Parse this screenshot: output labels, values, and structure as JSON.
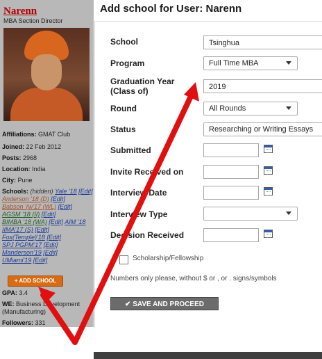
{
  "sidebar": {
    "name": "Narenn",
    "role": "MBA Section Director",
    "affiliations_label": "Affiliations:",
    "affiliations_value": "GMAT Club",
    "joined_label": "Joined:",
    "joined_value": "22 Feb 2012",
    "posts_label": "Posts:",
    "posts_value": "2968",
    "location_label": "Location:",
    "location_value": "India",
    "city_label": "City:",
    "city_value": "Pune",
    "schools_label": "Schools:",
    "schools_hidden": "(hidden)",
    "schools": [
      {
        "text": "Yale '18",
        "edit": "[Edit]"
      },
      {
        "text": "Anderson '18 (D)",
        "edit": "[Edit]"
      },
      {
        "text": "Babson '(w'17 (WL)",
        "edit": "[Edit]"
      },
      {
        "text": "AGSM '18 (II)",
        "edit": "[Edit]"
      },
      {
        "text": "BIMBA '18 (WA)",
        "edit": "[Edit]"
      },
      {
        "text": "AIM '18",
        "edit": ""
      },
      {
        "text": "IIMA'17 (S)",
        "edit": "[Edit]"
      },
      {
        "text": "Fox(Temple)'18",
        "edit": "[Edit]"
      },
      {
        "text": "SPJ PGPM'17",
        "edit": "[Edit]"
      },
      {
        "text": "Manderson'19",
        "edit": "[Edit]"
      },
      {
        "text": "UMiami'19",
        "edit": "[Edit]"
      }
    ],
    "add_school_button": "+ ADD SCHOOL",
    "gpa_label": "GPA:",
    "gpa_value": "3.4",
    "we_label": "WE:",
    "we_value_1": "Business Development",
    "we_value_2": "(Manufacturing)",
    "followers_label": "Followers:",
    "followers_value": "331"
  },
  "form": {
    "title": "Add school for User: Narenn",
    "school_label": "School",
    "school_value": "Tsinghua",
    "program_label": "Program",
    "program_value": "Full Time MBA",
    "grad_year_label_1": "Graduation Year",
    "grad_year_label_2": "(Class of)",
    "grad_year_value": "2019",
    "round_label": "Round",
    "round_value": "All Rounds",
    "status_label": "Status",
    "status_value": "Researching or Writing Essays",
    "submitted_label": "Submitted",
    "invite_label": "Invite Received on",
    "interview_date_label": "Interview Date",
    "interview_type_label": "Interview Type",
    "decision_label": "Decision Received",
    "scholarship_label": "Scholarship/Fellowship",
    "note": "Numbers only please, without $ or , or . signs/symbols",
    "save_button": "SAVE AND PROCEED"
  },
  "colors": {
    "annotation_arrow": "#e01010",
    "add_school_button": "#d86b13",
    "user_name": "#b00000"
  }
}
